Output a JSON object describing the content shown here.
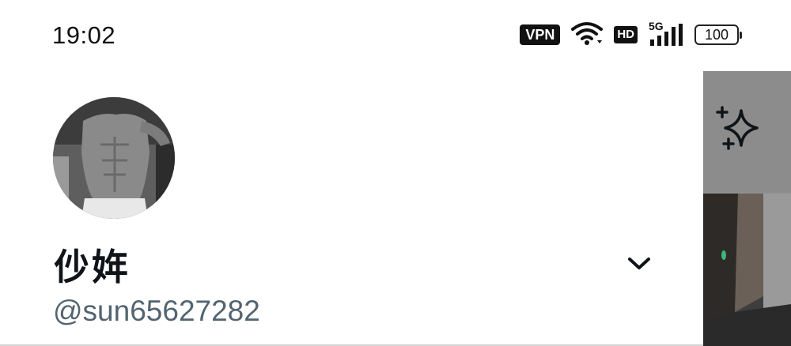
{
  "status_bar": {
    "time": "19:02",
    "vpn_label": "VPN",
    "hd_label": "HD",
    "network_label": "5G",
    "battery_level": "100",
    "icons": [
      "wifi-icon",
      "signal-icon"
    ]
  },
  "profile": {
    "avatar_icon": "profile-photo",
    "display_name": "仯姩",
    "handle": "@sun65627282",
    "expand_icon": "chevron-down-icon"
  },
  "side_panel": {
    "sparkle_icon": "sparkle-icon",
    "thumbnail": "media-thumbnail"
  },
  "colors": {
    "text_primary": "#0f1419",
    "text_secondary": "#536471",
    "overlay": "#8f8f8f"
  }
}
